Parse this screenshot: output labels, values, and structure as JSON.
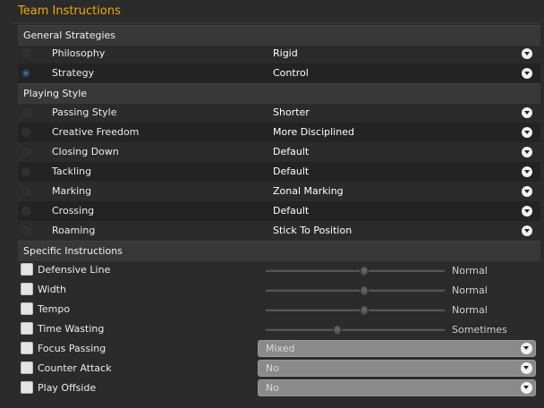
{
  "title": "Team Instructions",
  "general": {
    "heading": "General Strategies",
    "rows": [
      {
        "label": "Philosophy",
        "value": "Rigid"
      },
      {
        "label": "Strategy",
        "value": "Control"
      }
    ]
  },
  "playing": {
    "heading": "Playing Style",
    "rows": [
      {
        "label": "Passing Style",
        "value": "Shorter"
      },
      {
        "label": "Creative Freedom",
        "value": "More Disciplined"
      },
      {
        "label": "Closing Down",
        "value": "Default"
      },
      {
        "label": "Tackling",
        "value": "Default"
      },
      {
        "label": "Marking",
        "value": "Zonal Marking"
      },
      {
        "label": "Crossing",
        "value": "Default"
      },
      {
        "label": "Roaming",
        "value": "Stick To Position"
      }
    ]
  },
  "specific": {
    "heading": "Specific Instructions",
    "sliders": [
      {
        "label": "Defensive Line",
        "value": "Normal",
        "level": 0.55
      },
      {
        "label": "Width",
        "value": "Normal",
        "level": 0.55
      },
      {
        "label": "Tempo",
        "value": "Normal",
        "level": 0.55
      },
      {
        "label": "Time Wasting",
        "value": "Sometimes",
        "level": 0.4
      }
    ],
    "selects": [
      {
        "label": "Focus Passing",
        "value": "Mixed"
      },
      {
        "label": "Counter Attack",
        "value": "No"
      },
      {
        "label": "Play Offside",
        "value": "No"
      }
    ]
  },
  "icons": {
    "dropdown": "chevron-down-icon",
    "selected_radio": "radio-selected-icon"
  },
  "colors": {
    "title": "#f0a800",
    "background": "#2b2b2b",
    "section": "#383838"
  }
}
